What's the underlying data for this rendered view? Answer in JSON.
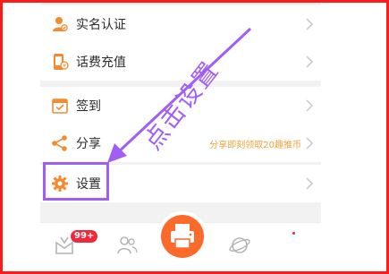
{
  "menu": {
    "items": [
      {
        "label": "实名认证"
      },
      {
        "label": "话费充值"
      },
      {
        "label": "签到"
      },
      {
        "label": "分享",
        "hint": "分享即刻领取20趣推币"
      },
      {
        "label": "设置"
      }
    ]
  },
  "tabbar": {
    "badge": "99+"
  },
  "annotation": {
    "text": "点击设置"
  },
  "colors": {
    "accent": "#fb6a2a",
    "annotation": "#a05ef5",
    "frame": "#ff1a1a",
    "badge": "#f0283c",
    "hint": "#f0a23c"
  },
  "icons": [
    "user-verify-icon",
    "phone-recharge-icon",
    "calendar-checkin-icon",
    "share-icon",
    "gear-icon",
    "chevron-right-icon",
    "printer-icon",
    "people-icon"
  ]
}
